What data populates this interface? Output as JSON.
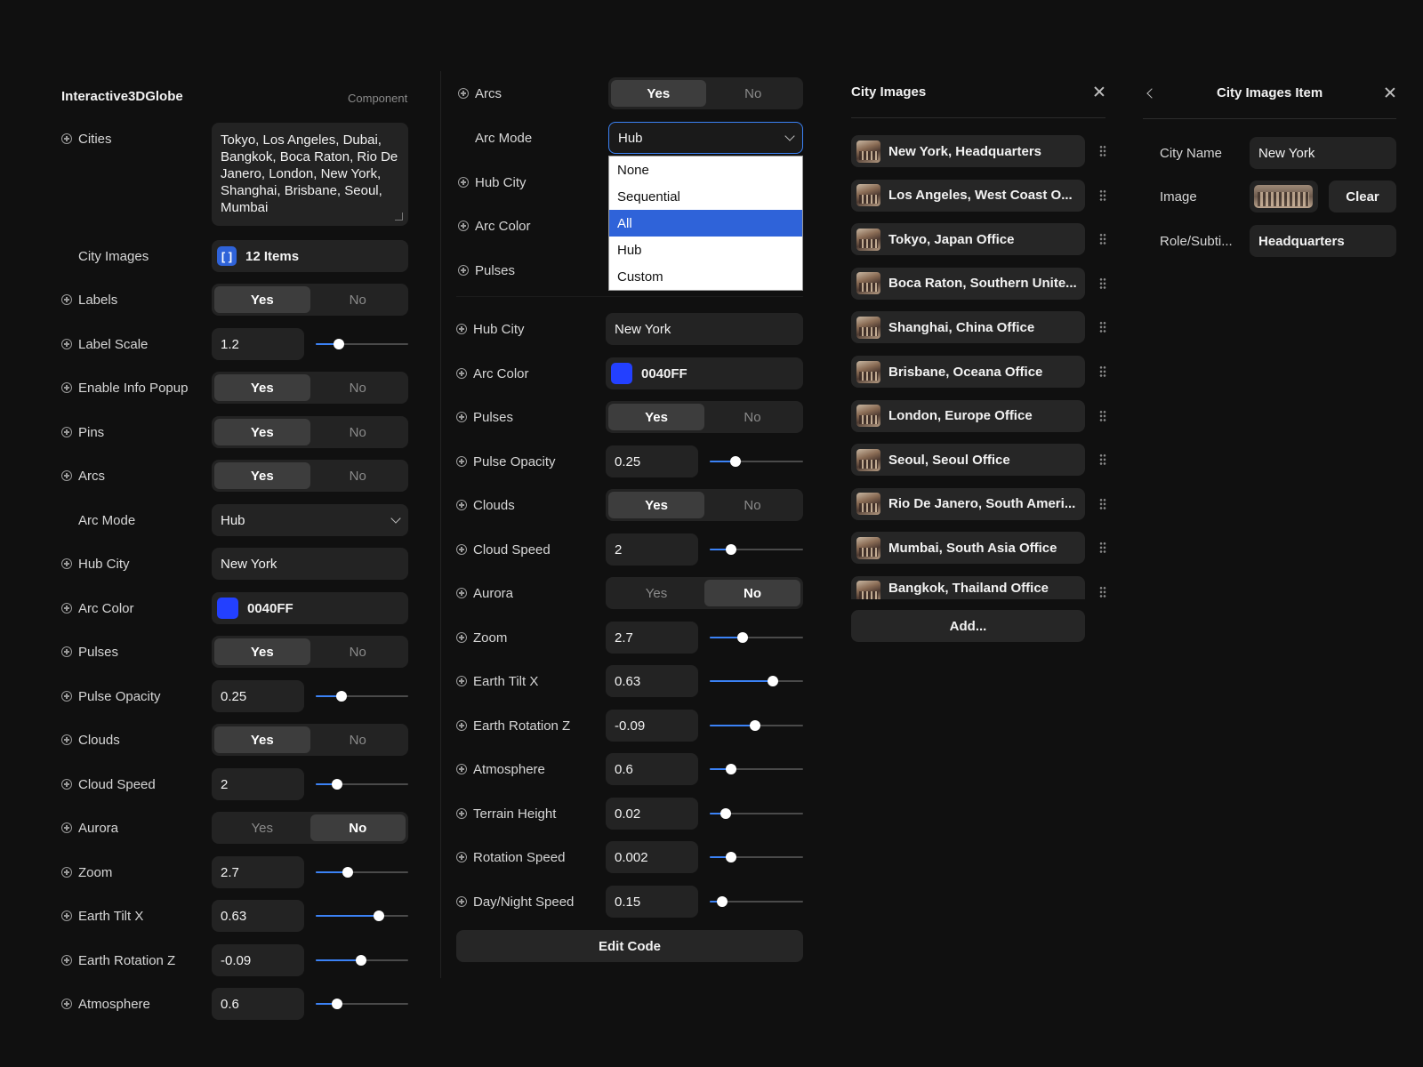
{
  "panel1": {
    "title": "Interactive3DGlobe",
    "subtitle": "Component",
    "cities_label": "Cities",
    "cities_value": "Tokyo, Los Angeles, Dubai, Bangkok, Boca Raton, Rio De Janero, London, New York, Shanghai, Brisbane, Seoul, Mumbai",
    "city_images_label": "City Images",
    "city_images_badge": "[ ]",
    "city_images_value": "12 Items",
    "labels_label": "Labels",
    "label_scale_label": "Label Scale",
    "label_scale_value": "1.2",
    "info_popup_label": "Enable Info Popup",
    "pins_label": "Pins",
    "arcs_label": "Arcs",
    "arc_mode_label": "Arc Mode",
    "arc_mode_value": "Hub",
    "hub_city_label": "Hub City",
    "hub_city_value": "New York",
    "arc_color_label": "Arc Color",
    "arc_color_value": "0040FF",
    "pulses_label": "Pulses",
    "pulse_opacity_label": "Pulse Opacity",
    "pulse_opacity_value": "0.25",
    "clouds_label": "Clouds",
    "cloud_speed_label": "Cloud Speed",
    "cloud_speed_value": "2",
    "aurora_label": "Aurora",
    "zoom_label": "Zoom",
    "zoom_value": "2.7",
    "tilt_label": "Earth Tilt X",
    "tilt_value": "0.63",
    "rotz_label": "Earth Rotation Z",
    "rotz_value": "-0.09",
    "atmo_label": "Atmosphere",
    "atmo_value": "0.6"
  },
  "panel2": {
    "arcs_label": "Arcs",
    "arc_mode_label": "Arc Mode",
    "arc_mode_value": "Hub",
    "hub_city_label_top": "Hub City",
    "arc_color_label_top": "Arc Color",
    "pulses_label_top": "Pulses",
    "dropdown_options": [
      "None",
      "Sequential",
      "All",
      "Hub",
      "Custom"
    ],
    "dropdown_selected_index": 2,
    "hub_city_label": "Hub City",
    "hub_city_value": "New York",
    "arc_color_label": "Arc Color",
    "arc_color_value": "0040FF",
    "pulses_label": "Pulses",
    "pulse_opacity_label": "Pulse Opacity",
    "pulse_opacity_value": "0.25",
    "clouds_label": "Clouds",
    "cloud_speed_label": "Cloud Speed",
    "cloud_speed_value": "2",
    "aurora_label": "Aurora",
    "zoom_label": "Zoom",
    "zoom_value": "2.7",
    "tilt_label": "Earth Tilt X",
    "tilt_value": "0.63",
    "rotz_label": "Earth Rotation Z",
    "rotz_value": "-0.09",
    "atmo_label": "Atmosphere",
    "atmo_value": "0.6",
    "terrain_label": "Terrain Height",
    "terrain_value": "0.02",
    "rotspeed_label": "Rotation Speed",
    "rotspeed_value": "0.002",
    "daynight_label": "Day/Night Speed",
    "daynight_value": "0.15",
    "edit_code_label": "Edit Code"
  },
  "toggle": {
    "yes": "Yes",
    "no": "No"
  },
  "panel3": {
    "title": "City Images",
    "items": [
      "New York, Headquarters",
      "Los Angeles, West Coast O...",
      "Tokyo, Japan Office",
      "Boca Raton, Southern Unite...",
      "Shanghai, China Office",
      "Brisbane, Oceana Office",
      "London, Europe Office",
      "Seoul, Seoul Office",
      "Rio De Janero, South Ameri...",
      "Mumbai, South Asia Office",
      "Bangkok, Thailand Office"
    ],
    "add_label": "Add..."
  },
  "panel4": {
    "title": "City Images Item",
    "city_name_label": "City Name",
    "city_name_value": "New York",
    "image_label": "Image",
    "clear_label": "Clear",
    "role_label": "Role/Subti...",
    "role_value": "Headquarters"
  },
  "colors": {
    "accent": "#3b82f6",
    "arc_color": "#2340ff",
    "selection": "#2f63d9"
  },
  "slider_levels": {
    "p1_label_scale": 0.25,
    "p1_pulse_opacity": 0.28,
    "p1_cloud_speed": 0.23,
    "p1_zoom": 0.35,
    "p1_tilt": 0.68,
    "p1_rotz": 0.49,
    "p1_atmo": 0.23,
    "p2_pulse_opacity": 0.28,
    "p2_cloud_speed": 0.23,
    "p2_zoom": 0.35,
    "p2_tilt": 0.68,
    "p2_rotz": 0.49,
    "p2_atmo": 0.23,
    "p2_terrain": 0.17,
    "p2_rotspeed": 0.23,
    "p2_daynight": 0.13
  },
  "icons": {
    "row": "plus-circle-icon",
    "select": "chevron-down-icon",
    "close": "close-icon",
    "back": "chevron-left-icon",
    "drag": "drag-handle-icon"
  }
}
